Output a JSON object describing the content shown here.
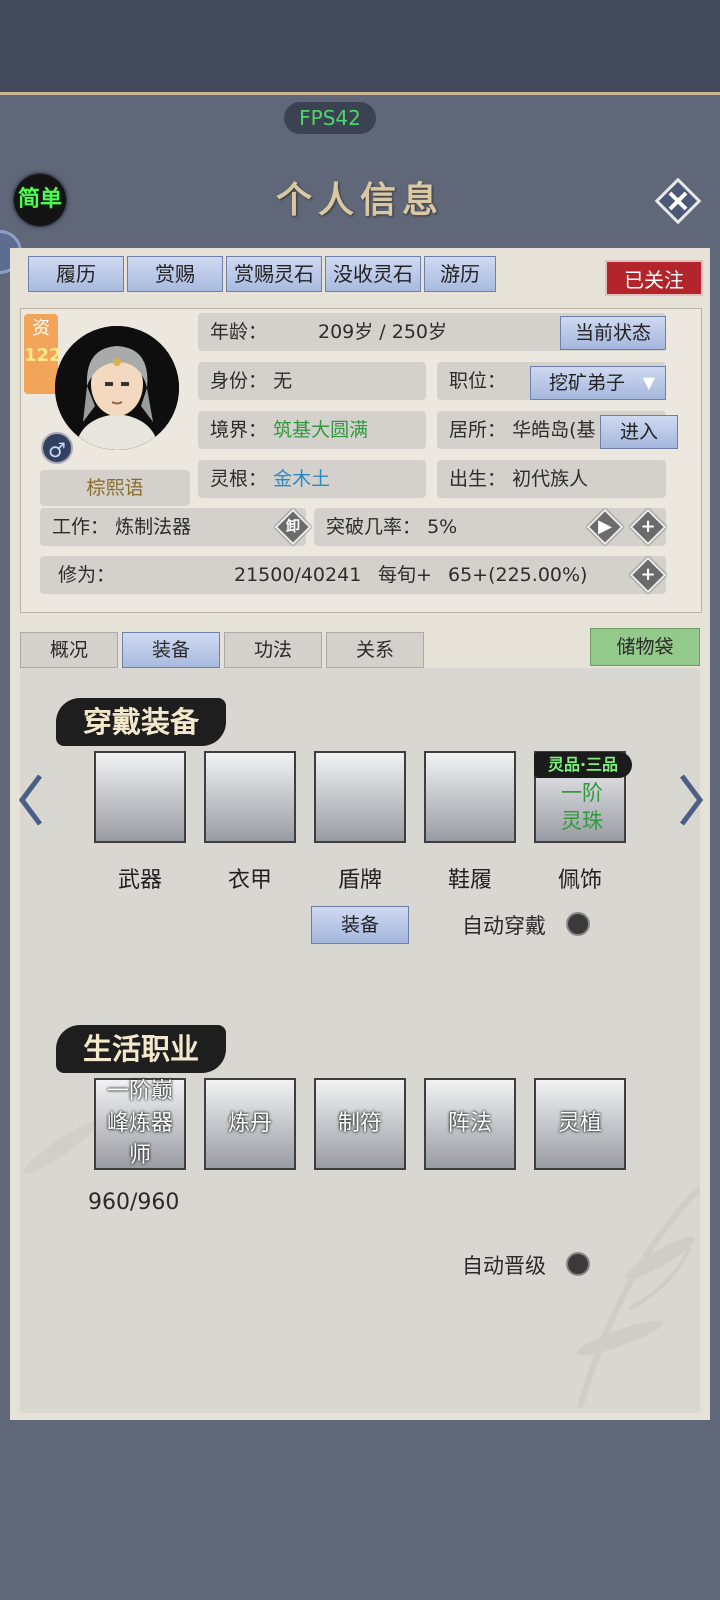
{
  "fps": "FPS42",
  "mode_label": "简单",
  "title": "个人信息",
  "tabs": [
    "履历",
    "赏赐",
    "赏赐灵石",
    "没收灵石",
    "游历"
  ],
  "follow_label": "已关注",
  "character": {
    "zi_label": "资",
    "zi_value": "122",
    "gender": "♂",
    "name": "棕熙语"
  },
  "fields": {
    "age_label": "年龄：",
    "age_value": "209岁 / 250岁",
    "status_button": "当前状态",
    "identity_label": "身份：",
    "identity_value": "无",
    "position_label": "职位：",
    "position_value": "挖矿弟子",
    "realm_label": "境界：",
    "realm_value": "筑基大圆满",
    "residence_label": "居所：",
    "residence_value": "华皓岛(基",
    "enter_button": "进入",
    "root_label": "灵根：",
    "root_value": "金木土",
    "birth_label": "出生：",
    "birth_value": "初代族人",
    "work_label": "工作：",
    "work_value": "炼制法器",
    "unequip_label": "卸",
    "breakthrough_label": "突破几率：",
    "breakthrough_value": "5%",
    "cultivation_label": "修为：",
    "cultivation_value": "21500/40241",
    "per_turn_label": "每旬+",
    "per_turn_value": "65+(225.00%)"
  },
  "subtabs": [
    "概况",
    "装备",
    "功法",
    "关系"
  ],
  "bag_label": "储物袋",
  "equip_section": {
    "title": "穿戴装备",
    "slots": [
      "武器",
      "衣甲",
      "盾牌",
      "鞋履",
      "佩饰"
    ],
    "accessory_grade": "灵品·三品",
    "accessory_item": "一阶灵珠",
    "equip_button": "装备",
    "auto_wear_label": "自动穿戴"
  },
  "life_section": {
    "title": "生活职业",
    "jobs": [
      "一阶巅峰炼器师",
      "炼丹",
      "制符",
      "阵法",
      "灵植"
    ],
    "progress": "960/960",
    "auto_promote_label": "自动晋级"
  }
}
